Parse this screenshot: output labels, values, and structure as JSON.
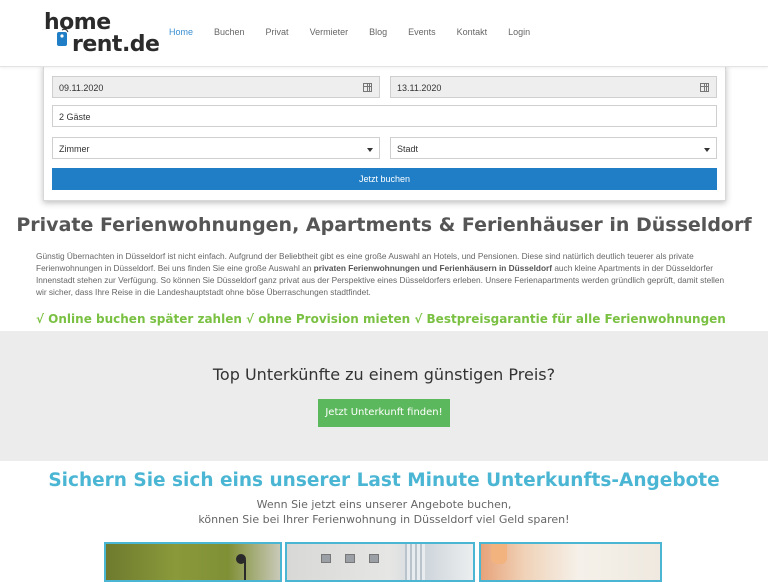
{
  "header": {
    "logo": {
      "word1": "home",
      "word2": "rent.de"
    },
    "nav": [
      {
        "label": "Home",
        "active": true
      },
      {
        "label": "Buchen"
      },
      {
        "label": "Privat"
      },
      {
        "label": "Vermieter"
      },
      {
        "label": "Blog"
      },
      {
        "label": "Events"
      },
      {
        "label": "Kontakt"
      },
      {
        "label": "Login"
      }
    ]
  },
  "booking": {
    "checkin": "09.11.2020",
    "checkout": "13.11.2020",
    "guests": "2 Gäste",
    "room_type": "Zimmer",
    "city": "Stadt",
    "submit": "Jetzt buchen"
  },
  "intro": {
    "heading": "Private Ferienwohnungen, Apartments & Ferienhäuser in Düsseldorf",
    "p1": "Günstig Übernachten in  Düsseldorf ist nicht einfach. Aufgrund der Beliebtheit gibt es eine  große Auswahl an Hotels, und Pensionen. Diese sind natürlich deutlich teuerer als private Ferienwohnungen in Düsseldorf. Bei uns finden Sie eine große Auswahl an ",
    "p1_bold": "privaten Ferienwohnungen und Ferienhäusern in Düsseldorf",
    "p2": " auch kleine Apartments in der Düsseldorfer Innenstadt stehen zur Verfügung. So können Sie Düsseldorf ganz privat  aus der Perspektive eines Düsseldorfers erleben. Unsere Ferienapartments werden gründlich geprüft, damit stellen wir sicher, dass Ihre Reise in die Landeshauptstadt ohne böse Überraschungen stadtfindet.",
    "usp": "√ Online buchen später zahlen √ ohne Provision mieten √ Bestpreisgarantie für alle Ferienwohnungen"
  },
  "cta": {
    "heading": "Top Unterkünfte zu einem günstigen Preis?",
    "button": "Jetzt Unterkunft finden!"
  },
  "last_minute": {
    "heading": "Sichern Sie sich eins unserer Last Minute Unterkunfts-Angebote",
    "line1": "Wenn Sie jetzt eins unserer Angebote buchen,",
    "line2": "können Sie bei Ihrer Ferienwohnung in Düsseldorf viel Geld sparen!"
  },
  "colors": {
    "accent_blue": "#1f7ec6",
    "nav_active": "#3a8fd0",
    "usp_green": "#7ac143",
    "cta_green": "#5cb85c",
    "lm_teal": "#4bb6d4"
  }
}
